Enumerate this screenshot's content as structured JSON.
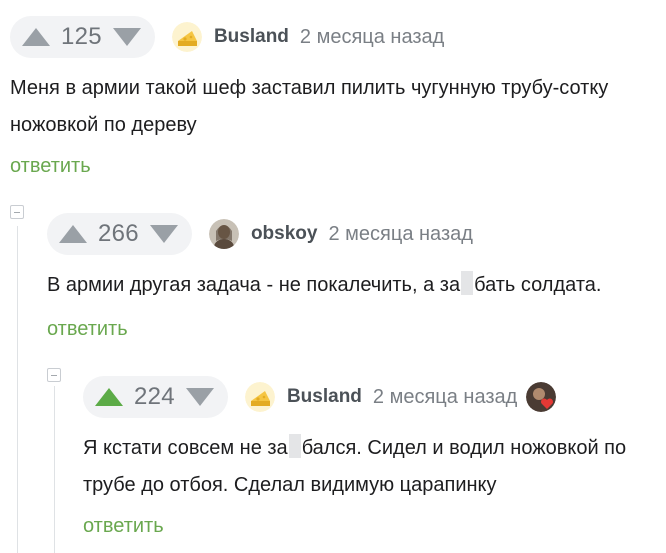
{
  "comments": [
    {
      "rating": "125",
      "voted": "none",
      "author": "Busland",
      "avatar": "cheese-avatar",
      "time": "2 месяца назад",
      "lines": [
        "Меня в армии такой шеф заставил пилить чугунную трубу-сотку",
        "ножовкой по дереву"
      ],
      "reply": "ответить"
    },
    {
      "rating": "266",
      "voted": "none",
      "author": "obskoy",
      "avatar": "photo-avatar",
      "time": "2 месяца назад",
      "line1_before": "В армии другая задача - не покалечить, а за",
      "line1_after": "бать солдата.",
      "reply": "ответить"
    },
    {
      "rating": "224",
      "voted": "up",
      "author": "Busland",
      "avatar": "cheese-avatar",
      "time": "2 месяца назад",
      "line1_before": "Я кстати совсем не за",
      "line1_after": "бался. Сидел и водил ножовкой по",
      "line2": "трубе до отбоя. Сделал видимую царапинку",
      "reply": "ответить"
    }
  ],
  "colors": {
    "upvote_active": "#5cab47",
    "vote_inactive": "#9aa0a6",
    "reply": "#6aa84f",
    "rating_bg": "#f2f3f5"
  },
  "icons": {
    "upvote": "triangle-up-icon",
    "downvote": "triangle-down-icon",
    "collapse": "minus-square-icon",
    "like_badge": "heart-icon"
  }
}
